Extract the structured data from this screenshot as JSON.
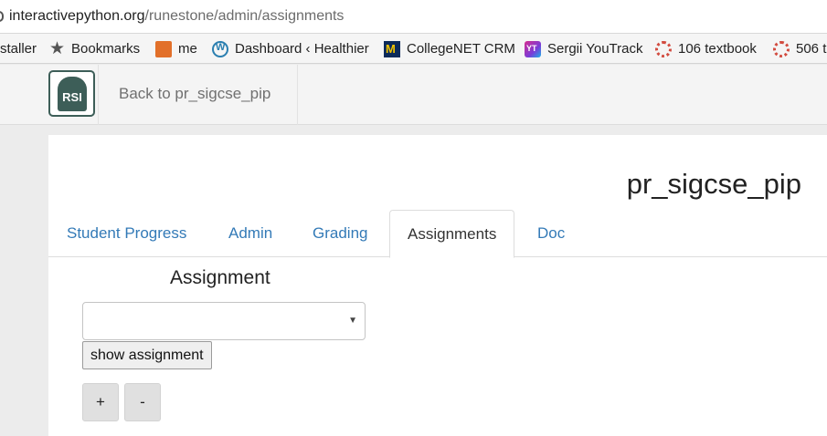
{
  "browser": {
    "url_host": "interactivepython.org",
    "url_path": "/runestone/admin/assignments"
  },
  "bookmarks": [
    {
      "label": "staller",
      "icon": "none"
    },
    {
      "label": "Bookmarks",
      "icon": "star-icon"
    },
    {
      "label": "me",
      "icon": "me-bookmark-icon"
    },
    {
      "label": "Dashboard ‹ Healthier",
      "icon": "wordpress-icon"
    },
    {
      "label": "CollegeNET CRM",
      "icon": "michigan-m-icon"
    },
    {
      "label": "Sergii YouTrack",
      "icon": "youtrack-icon"
    },
    {
      "label": "106 textbook",
      "icon": "runestone-cog-icon"
    },
    {
      "label": "506 t",
      "icon": "runestone-cog-icon"
    }
  ],
  "navbar": {
    "logo_text": "RSI",
    "back_link": "Back to pr_sigcse_pip"
  },
  "page": {
    "course_title": "pr_sigcse_pip",
    "tabs": [
      {
        "label": "Student Progress",
        "active": false
      },
      {
        "label": "Admin",
        "active": false
      },
      {
        "label": "Grading",
        "active": false
      },
      {
        "label": "Assignments",
        "active": true
      },
      {
        "label": "Doc",
        "active": false
      }
    ],
    "assignment_label": "Assignment",
    "assignment_select_value": "",
    "show_button": "show assignment",
    "add_button": "+",
    "remove_button": "-"
  },
  "colors": {
    "link": "#337ab7",
    "logo": "#3d5e58"
  }
}
